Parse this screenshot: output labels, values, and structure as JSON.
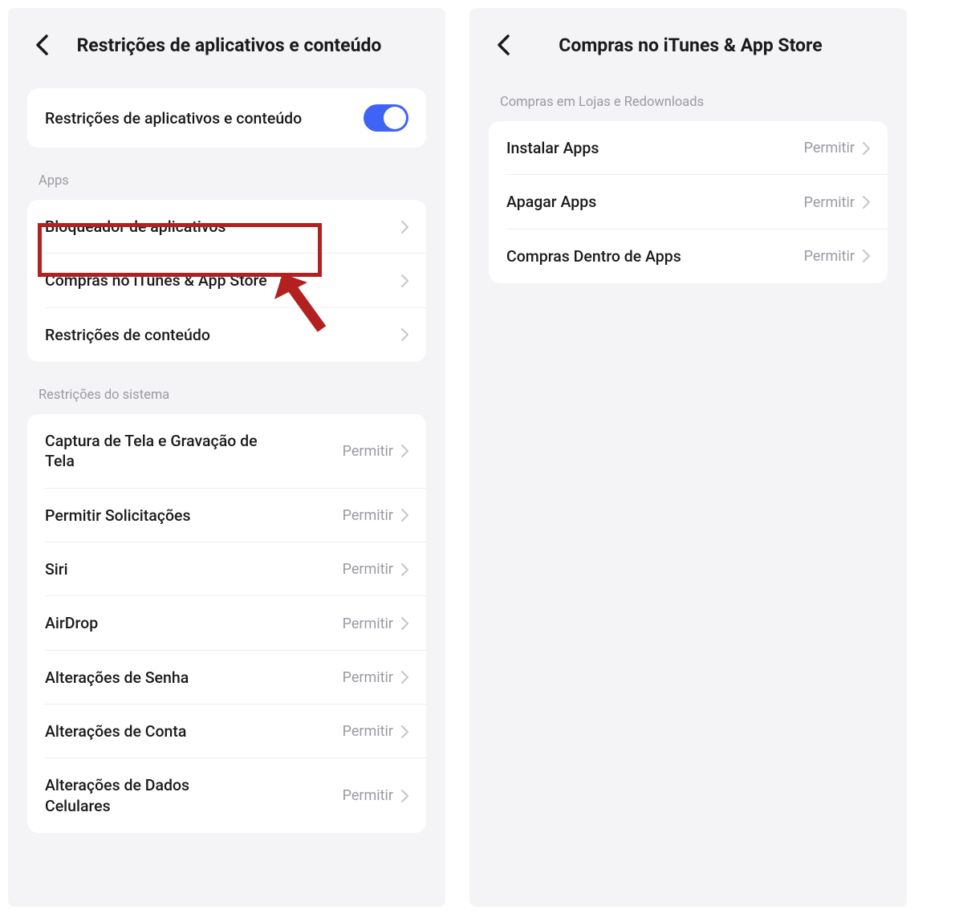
{
  "left": {
    "title": "Restrições de aplicativos e conteúdo",
    "toggle": {
      "label": "Restrições de aplicativos e conteúdo"
    },
    "section_apps_header": "Apps",
    "apps_items": [
      {
        "label": "Bloqueador de aplicativos"
      },
      {
        "label": "Compras no iTunes & App Store"
      },
      {
        "label": "Restrições de conteúdo"
      }
    ],
    "section_system_header": "Restrições do sistema",
    "system_items": [
      {
        "label": "Captura de Tela e Gravação de Tela",
        "value": "Permitir"
      },
      {
        "label": "Permitir Solicitações",
        "value": "Permitir"
      },
      {
        "label": "Siri",
        "value": "Permitir"
      },
      {
        "label": "AirDrop",
        "value": "Permitir"
      },
      {
        "label": "Alterações de Senha",
        "value": "Permitir"
      },
      {
        "label": "Alterações de Conta",
        "value": "Permitir"
      },
      {
        "label": "Alterações de Dados Celulares",
        "value": "Permitir"
      }
    ]
  },
  "right": {
    "title": "Compras no iTunes & App Store",
    "section_header": "Compras em Lojas e Redownloads",
    "items": [
      {
        "label": "Instalar Apps",
        "value": "Permitir"
      },
      {
        "label": "Apagar Apps",
        "value": "Permitir"
      },
      {
        "label": "Compras Dentro de Apps",
        "value": "Permitir"
      }
    ]
  }
}
